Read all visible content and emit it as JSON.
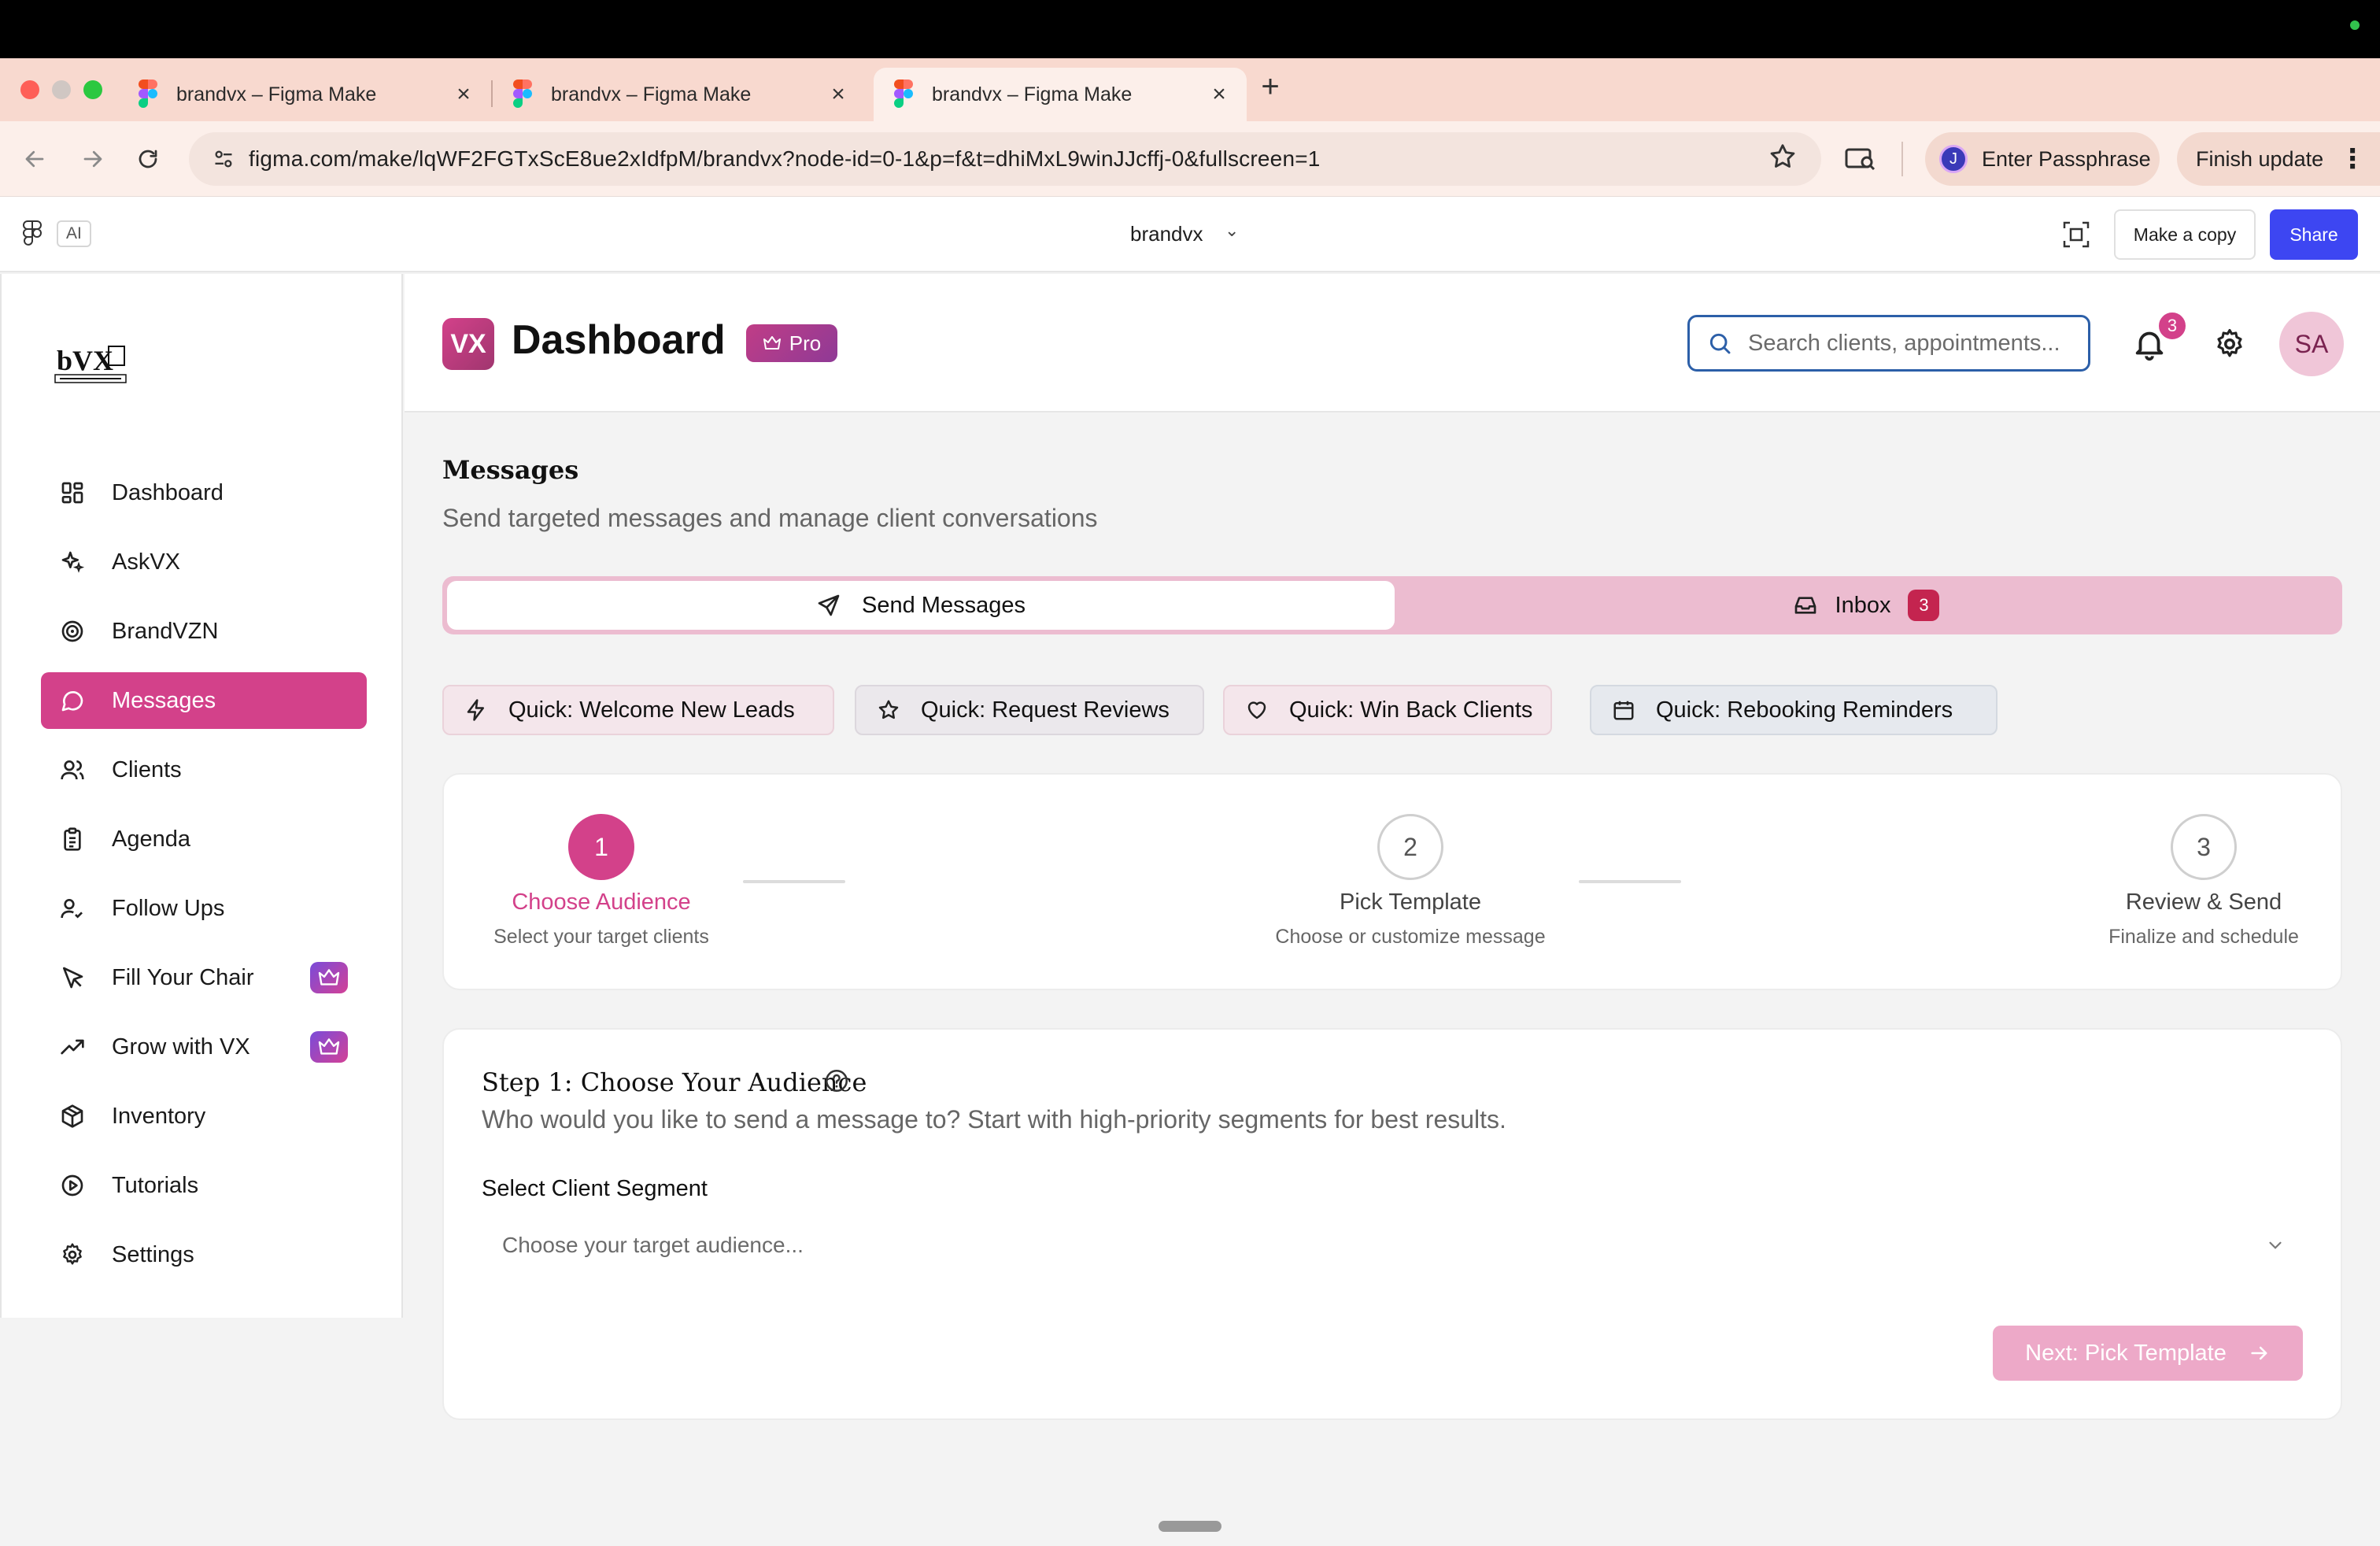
{
  "browser": {
    "tabs": [
      {
        "title": "brandvx – Figma Make",
        "active": false
      },
      {
        "title": "brandvx – Figma Make",
        "active": false
      },
      {
        "title": "brandvx – Figma Make",
        "active": true
      }
    ],
    "close_glyph": "×",
    "new_tab_glyph": "+",
    "url": "figma.com/make/lqWF2FGTxScE8ue2xIdfpM/brandvx?node-id=0-1&p=f&t=dhiMxL9winJJcffj-0&fullscreen=1",
    "profile_initial": "J",
    "passphrase_label": "Enter Passphrase",
    "update_label": "Finish update"
  },
  "figma": {
    "ai_label": "AI",
    "file_name": "brandvx",
    "copy_label": "Make a copy",
    "share_label": "Share"
  },
  "sidebar": {
    "items": [
      {
        "label": "Dashboard",
        "icon": "dashboard-icon",
        "active": false,
        "pro": false
      },
      {
        "label": "AskVX",
        "icon": "sparkles-icon",
        "active": false,
        "pro": false
      },
      {
        "label": "BrandVZN",
        "icon": "target-icon",
        "active": false,
        "pro": false
      },
      {
        "label": "Messages",
        "icon": "message-icon",
        "active": true,
        "pro": false
      },
      {
        "label": "Clients",
        "icon": "users-icon",
        "active": false,
        "pro": false
      },
      {
        "label": "Agenda",
        "icon": "clipboard-icon",
        "active": false,
        "pro": false
      },
      {
        "label": "Follow Ups",
        "icon": "user-check-icon",
        "active": false,
        "pro": false
      },
      {
        "label": "Fill Your Chair",
        "icon": "cursor-icon",
        "active": false,
        "pro": true
      },
      {
        "label": "Grow with VX",
        "icon": "trending-up-icon",
        "active": false,
        "pro": true
      },
      {
        "label": "Inventory",
        "icon": "package-icon",
        "active": false,
        "pro": false
      },
      {
        "label": "Tutorials",
        "icon": "play-circle-icon",
        "active": false,
        "pro": false
      },
      {
        "label": "Settings",
        "icon": "gear-icon",
        "active": false,
        "pro": false
      }
    ]
  },
  "header": {
    "logo_text": "VX",
    "title": "Dashboard",
    "pro_label": "Pro",
    "search_placeholder": "Search clients, appointments...",
    "notification_count": "3",
    "avatar_initials": "SA"
  },
  "messages": {
    "title": "Messages",
    "subtitle": "Send targeted messages and manage client conversations",
    "tabs": {
      "send": "Send Messages",
      "inbox": "Inbox",
      "inbox_count": "3"
    },
    "quick_actions": [
      {
        "label": "Quick: Welcome New Leads",
        "icon": "zap-icon"
      },
      {
        "label": "Quick: Request Reviews",
        "icon": "star-icon"
      },
      {
        "label": "Quick: Win Back Clients",
        "icon": "heart-icon"
      },
      {
        "label": "Quick: Rebooking Reminders",
        "icon": "calendar-icon"
      }
    ],
    "steps": [
      {
        "number": "1",
        "title": "Choose Audience",
        "desc": "Select your target clients",
        "active": true
      },
      {
        "number": "2",
        "title": "Pick Template",
        "desc": "Choose or customize message",
        "active": false
      },
      {
        "number": "3",
        "title": "Review & Send",
        "desc": "Finalize and schedule",
        "active": false
      }
    ],
    "audience": {
      "title": "Step 1: Choose Your Audience",
      "subtitle": "Who would you like to send a message to? Start with high-priority segments for best results.",
      "segment_label": "Select Client Segment",
      "segment_placeholder": "Choose your target audience...",
      "next_label": "Next: Pick Template"
    }
  },
  "colors": {
    "brand_pink": "#d3418a",
    "tab_bar_pink": "#ecbcd0",
    "share_blue": "#3d46f2",
    "inbox_badge": "#c4244f"
  }
}
